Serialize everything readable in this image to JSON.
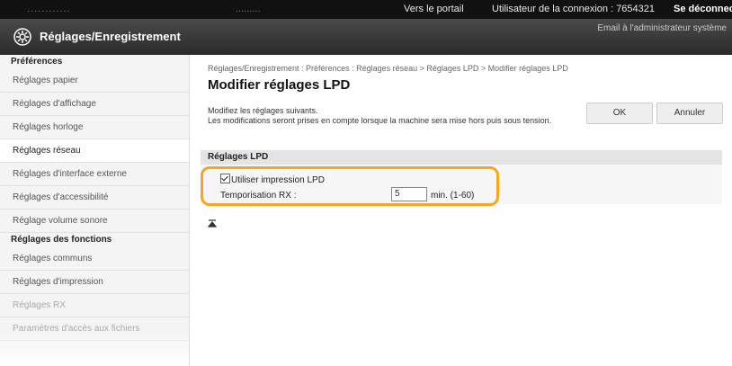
{
  "topbar": {
    "left_text": "............",
    "mid_text": ".........",
    "portal_link": "Vers le portail",
    "user_label": "Utilisateur de la connexion : 7654321",
    "logout_link": "Se déconnecter"
  },
  "header": {
    "icon": "settings-gear-icon",
    "title": "Réglages/Enregistrement",
    "mail_link": "Email à l'administrateur système"
  },
  "sidebar": {
    "groups": [
      {
        "label": "Préférences",
        "items": [
          {
            "label": "Réglages papier"
          },
          {
            "label": "Réglages d'affichage"
          },
          {
            "label": "Réglages horloge"
          },
          {
            "label": "Réglages réseau",
            "active": true
          },
          {
            "label": "Réglages d'interface externe"
          },
          {
            "label": "Réglages d'accessibilité"
          },
          {
            "label": "Réglage volume sonore"
          }
        ]
      },
      {
        "label": "Réglages des fonctions",
        "items": [
          {
            "label": "Réglages communs"
          },
          {
            "label": "Réglages d'impression"
          },
          {
            "label": "Réglages RX"
          },
          {
            "label": "Paramètres d'accès aux fichiers"
          }
        ]
      }
    ]
  },
  "main": {
    "breadcrumb": "Réglages/Enregistrement : Préférences : Réglages réseau > Réglages LPD > Modifier réglages LPD",
    "title": "Modifier réglages LPD",
    "description": "Modifiez les réglages suivants.\nLes modifications seront prises en compte lorsque la machine sera mise hors puis sous tension.",
    "ok_button": "OK",
    "cancel_button": "Annuler",
    "section_title": "Réglages LPD",
    "use_lpd_label": "Utiliser impression LPD",
    "use_lpd_checked": true,
    "rx_timeout_label": "Temporisation RX :",
    "rx_timeout_value": "5",
    "rx_timeout_unit": "min. (1-60)",
    "top_anchor_icon": "scroll-to-top-icon",
    "highlight_color": "#f5a623"
  }
}
